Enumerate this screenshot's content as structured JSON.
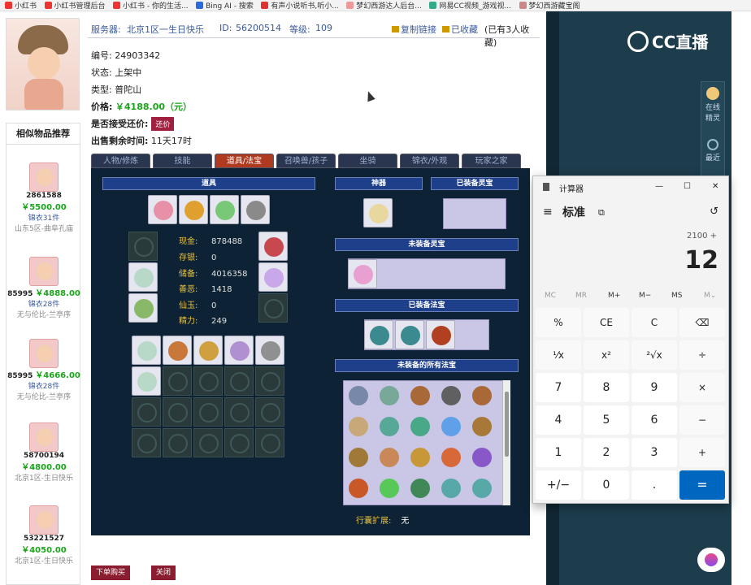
{
  "bookmarks": [
    "小红书",
    "小红书管理后台",
    "小红书 - 你的生活...",
    "Bing AI - 搜索",
    "有声小说听书,听小...",
    "梦幻西游达人后台...",
    "网易CC视频_游戏视...",
    "梦幻西游藏宝阁"
  ],
  "header": {
    "server_label": "服务器:",
    "server_value": "北京1区一生日快乐",
    "id_label": "ID:",
    "id_value": "56200514",
    "level_label": "等级:",
    "level_value": "109",
    "copy_link": "复制链接",
    "favorited": "已收藏",
    "fav_count": "(已有3人收藏)"
  },
  "fields": [
    {
      "label": "编号:",
      "value": "24903342"
    },
    {
      "label": "状态:",
      "value": "上架中"
    },
    {
      "label": "类型:",
      "value": "普陀山"
    },
    {
      "label": "价格:",
      "value": "￥4188.00（元）"
    },
    {
      "label": "是否接受还价:",
      "value": "还价"
    },
    {
      "label": "出售剩余时间:",
      "value": "11天17时"
    }
  ],
  "tabs": [
    "人物/修炼",
    "技能",
    "道具/法宝",
    "召唤兽/孩子",
    "坐骑",
    "锦衣/外观",
    "玩家之家"
  ],
  "panel": {
    "props_title": "道具",
    "artifact_title": "神器",
    "equipped_spirit_title": "已装备灵宝",
    "unequipped_spirit_title": "未装备灵宝",
    "equipped_fabao_title": "已装备法宝",
    "unequipped_fabao_title": "未装备的所有法宝",
    "bag_label": "行囊扩展:",
    "bag_value": "无"
  },
  "stats": [
    {
      "k": "现金:",
      "v": "878488"
    },
    {
      "k": "存银:",
      "v": "0"
    },
    {
      "k": "储备:",
      "v": "4016358"
    },
    {
      "k": "善恶:",
      "v": "1418"
    },
    {
      "k": "仙玉:",
      "v": "0"
    },
    {
      "k": "精力:",
      "v": "249"
    }
  ],
  "sidebar": {
    "title": "相似物品推荐",
    "items": [
      {
        "id": "2861588",
        "price": "￥5500.00",
        "jin": "锦衣31件",
        "server": "山东5区-曲阜孔庙"
      },
      {
        "id": "85995",
        "price": "￥4888.00",
        "jin": "锦衣28件",
        "server": "无与伦比-兰亭序"
      },
      {
        "id": "85995",
        "price": "￥4666.00",
        "jin": "锦衣28件",
        "server": "无与伦比-兰亭序"
      },
      {
        "id": "58700194",
        "price": "￥4800.00",
        "jin": "",
        "server": "北京1区-生日快乐"
      },
      {
        "id": "53221527",
        "price": "￥4050.00",
        "jin": "",
        "server": "北京1区-生日快乐"
      }
    ]
  },
  "buttons": {
    "buy": "下单购买",
    "close": "关闭"
  },
  "right": {
    "logo": "CC直播",
    "online": "在线",
    "spirit": "精灵",
    "recent": "最近"
  },
  "calc": {
    "app_title": "计算器",
    "mode": "标准",
    "expr": "2100 +",
    "result": "12",
    "mem": [
      "MC",
      "MR",
      "M+",
      "M−",
      "MS",
      "M⌄"
    ],
    "keys": [
      "%",
      "CE",
      "C",
      "⌫",
      "¹⁄x",
      "x²",
      "²√x",
      "÷",
      "7",
      "8",
      "9",
      "×",
      "4",
      "5",
      "6",
      "−",
      "1",
      "2",
      "3",
      "+",
      "+/−",
      "0",
      ".",
      "="
    ]
  }
}
